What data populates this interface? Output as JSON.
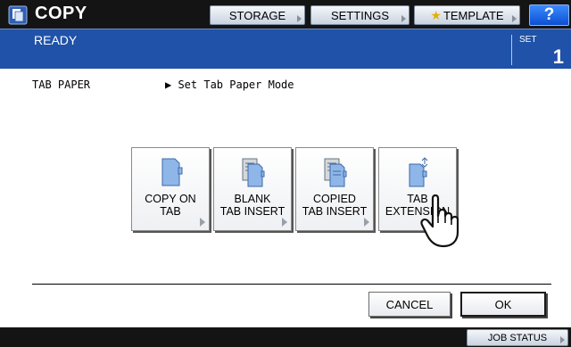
{
  "header": {
    "app_title": "COPY",
    "storage_label": "STORAGE",
    "settings_label": "SETTINGS",
    "template_label": "TEMPLATE",
    "help_label": "?"
  },
  "status": {
    "text": "READY",
    "set_label": "SET",
    "set_count": "1"
  },
  "main": {
    "title": "TAB PAPER",
    "subtitle": "▶ Set Tab Paper Mode",
    "modes": [
      {
        "line1": "COPY ON",
        "line2": "TAB",
        "icon": "tab-page-icon"
      },
      {
        "line1": "BLANK",
        "line2": "TAB INSERT",
        "icon": "blank-tab-insert-icon"
      },
      {
        "line1": "COPIED",
        "line2": "TAB INSERT",
        "icon": "copied-tab-insert-icon"
      },
      {
        "line1": "TAB",
        "line2": "EXTENSION",
        "icon": "tab-extension-icon"
      }
    ],
    "cancel_label": "CANCEL",
    "ok_label": "OK"
  },
  "footer": {
    "job_status_label": "JOB STATUS"
  },
  "colors": {
    "status_bar": "#1f52a8",
    "help_button": "#0b4fd0",
    "top_bar": "#141414"
  }
}
